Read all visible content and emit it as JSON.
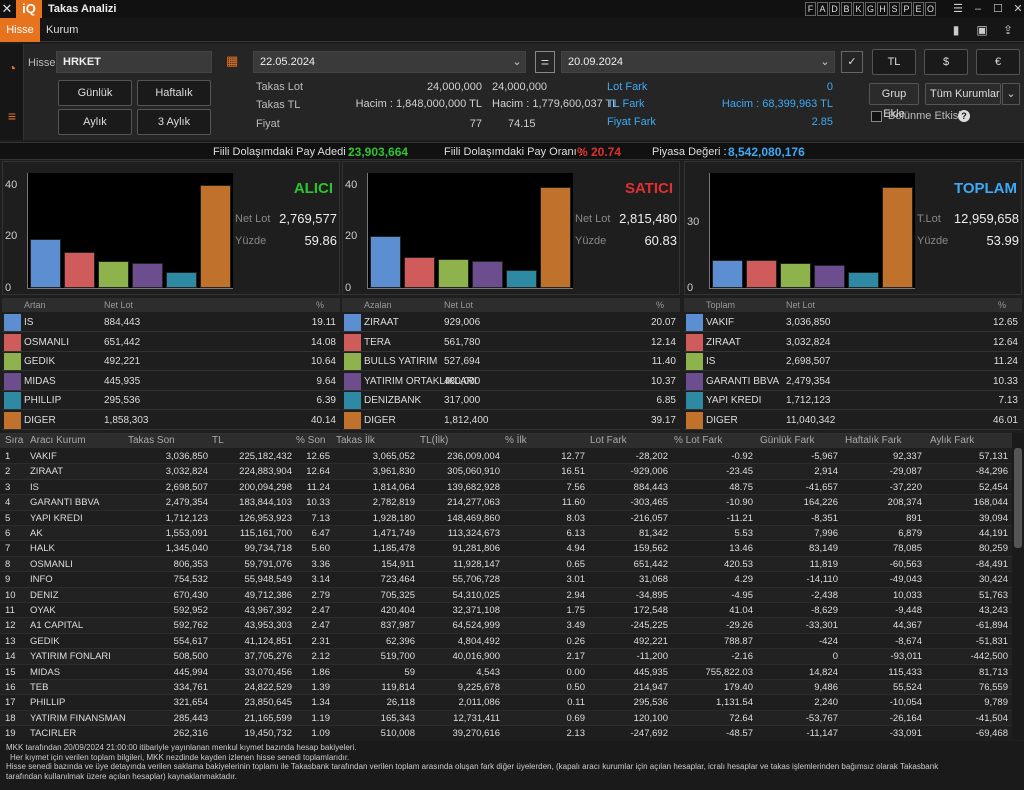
{
  "window": {
    "title": "Takas Analizi",
    "letters": [
      "F",
      "A",
      "D",
      "B",
      "K",
      "G",
      "H",
      "S",
      "P",
      "E",
      "O"
    ]
  },
  "menu": {
    "hisse": "Hisse",
    "kurum": "Kurum"
  },
  "form": {
    "hisse_label": "Hisse",
    "hisse_value": "HRKET",
    "date_from": "22.05.2024",
    "date_to": "20.09.2024",
    "eq": "=",
    "cur_tl": "TL",
    "cur_usd": "$",
    "cur_eur": "€",
    "btn_gunluk": "Günlük",
    "btn_haftalik": "Haftalık",
    "btn_aylik": "Aylık",
    "btn_3aylik": "3 Aylık",
    "grup_ekle": "Grup Ekle",
    "tum_kurumlar": "Tüm Kurumlar",
    "bolunme": "Bölünme Etkisi"
  },
  "summary": {
    "takas_lot_label": "Takas Lot",
    "takas_tl_label": "Takas TL",
    "fiyat_label": "Fiyat",
    "lot_1": "24,000,000",
    "lot_2": "24,000,000",
    "hacim_1": "Hacim : 1,848,000,000 TL",
    "hacim_2": "Hacim : 1,779,600,037 TL",
    "fiyat_1": "77",
    "fiyat_2": "74.15",
    "lot_fark_label": "Lot Fark",
    "lot_fark": "0",
    "tl_fark_label": "TL Fark",
    "tl_fark": "Hacim : 68,399,963 TL",
    "fiyat_fark_label": "Fiyat Fark",
    "fiyat_fark": "2.85"
  },
  "stats": {
    "pay_adedi_label": "Fiili Dolaşımdaki Pay Adedi :",
    "pay_adedi": "23,903,664",
    "pay_orani_label": "Fiili Dolaşımdaki Pay Oranı :",
    "pay_orani": "% 20.74",
    "piyasa_label": "Piyasa Değeri :",
    "piyasa": "8,542,080,176"
  },
  "colors": [
    "#5b8fd1",
    "#d05b5b",
    "#8fb34c",
    "#6c4d8e",
    "#2e8aa3",
    "#c0722c"
  ],
  "chart_data": [
    {
      "type": "bar",
      "title": "ALICI",
      "title_color": "#2fc42f",
      "ylim": [
        0,
        45
      ],
      "yticks": [
        0,
        20,
        40
      ],
      "values": [
        19.11,
        14.08,
        10.64,
        9.64,
        6.39,
        40.14
      ],
      "net_lot_label": "Net Lot",
      "net_lot": "2,769,577",
      "yuzde_label": "Yüzde",
      "yuzde": "59.86"
    },
    {
      "type": "bar",
      "title": "SATICI",
      "title_color": "#e03030",
      "ylim": [
        0,
        45
      ],
      "yticks": [
        0,
        20,
        40
      ],
      "values": [
        20.07,
        12.14,
        11.4,
        10.37,
        6.85,
        39.17
      ],
      "net_lot_label": "Net Lot",
      "net_lot": "2,815,480",
      "yuzde_label": "Yüzde",
      "yuzde": "60.83"
    },
    {
      "type": "bar",
      "title": "TOPLAM",
      "title_color": "#3fa9f5",
      "ylim": [
        0,
        53
      ],
      "yticks": [
        0,
        30
      ],
      "values": [
        12.65,
        12.64,
        11.24,
        10.33,
        7.13,
        46.01
      ],
      "net_lot_label": "T.Lot",
      "net_lot": "12,959,658",
      "yuzde_label": "Yüzde",
      "yuzde": "53.99"
    }
  ],
  "small_tables": [
    {
      "h1": "Artan",
      "h2": "Net Lot",
      "h3": "%",
      "rows": [
        [
          "IS",
          "884,443",
          "19.11"
        ],
        [
          "OSMANLI",
          "651,442",
          "14.08"
        ],
        [
          "GEDIK",
          "492,221",
          "10.64"
        ],
        [
          "MIDAS",
          "445,935",
          "9.64"
        ],
        [
          "PHILLIP",
          "295,536",
          "6.39"
        ],
        [
          "DIGER",
          "1,858,303",
          "40.14"
        ]
      ]
    },
    {
      "h1": "Azalan",
      "h2": "Net Lot",
      "h3": "%",
      "rows": [
        [
          "ZIRAAT",
          "929,006",
          "20.07"
        ],
        [
          "TERA",
          "561,780",
          "12.14"
        ],
        [
          "BULLS YATIRIM",
          "527,694",
          "11.40"
        ],
        [
          "YATIRIM ORTAKLIKLARI",
          "480,000",
          "10.37"
        ],
        [
          "DENIZBANK",
          "317,000",
          "6.85"
        ],
        [
          "DIGER",
          "1,812,400",
          "39.17"
        ]
      ]
    },
    {
      "h1": "Toplam",
      "h2": "Net Lot",
      "h3": "%",
      "rows": [
        [
          "VAKIF",
          "3,036,850",
          "12.65"
        ],
        [
          "ZIRAAT",
          "3,032,824",
          "12.64"
        ],
        [
          "IS",
          "2,698,507",
          "11.24"
        ],
        [
          "GARANTI BBVA",
          "2,479,354",
          "10.33"
        ],
        [
          "YAPI KREDI",
          "1,712,123",
          "7.13"
        ],
        [
          "DIGER",
          "11,040,342",
          "46.01"
        ]
      ]
    }
  ],
  "big_table": {
    "headers": [
      "Sıra",
      "Aracı Kurum",
      "Takas Son",
      "TL",
      "% Son",
      "Takas İlk",
      "TL(İlk)",
      "% İlk",
      "Lot Fark",
      "% Lot Fark",
      "Günlük Fark",
      "Haftalık Fark",
      "Aylık Fark"
    ],
    "rows": [
      [
        "1",
        "VAKIF",
        "3,036,850",
        "225,182,432",
        "12.65",
        "3,065,052",
        "236,009,004",
        "12.77",
        "-28,202",
        "-0.92",
        "-5,967",
        "92,337",
        "57,131"
      ],
      [
        "2",
        "ZIRAAT",
        "3,032,824",
        "224,883,904",
        "12.64",
        "3,961,830",
        "305,060,910",
        "16.51",
        "-929,006",
        "-23.45",
        "2,914",
        "-29,087",
        "-84,296"
      ],
      [
        "3",
        "IS",
        "2,698,507",
        "200,094,298",
        "11.24",
        "1,814,064",
        "139,682,928",
        "7.56",
        "884,443",
        "48.75",
        "-41,657",
        "-37,220",
        "52,454"
      ],
      [
        "4",
        "GARANTI BBVA",
        "2,479,354",
        "183,844,103",
        "10.33",
        "2,782,819",
        "214,277,063",
        "11.60",
        "-303,465",
        "-10.90",
        "164,226",
        "208,374",
        "168,044"
      ],
      [
        "5",
        "YAPI KREDI",
        "1,712,123",
        "126,953,923",
        "7.13",
        "1,928,180",
        "148,469,860",
        "8.03",
        "-216,057",
        "-11.21",
        "-8,351",
        "891",
        "39,094"
      ],
      [
        "6",
        "AK",
        "1,553,091",
        "115,161,700",
        "6.47",
        "1,471,749",
        "113,324,673",
        "6.13",
        "81,342",
        "5.53",
        "7,996",
        "6,879",
        "44,191"
      ],
      [
        "7",
        "HALK",
        "1,345,040",
        "99,734,718",
        "5.60",
        "1,185,478",
        "91,281,806",
        "4.94",
        "159,562",
        "13.46",
        "83,149",
        "78,085",
        "80,259"
      ],
      [
        "8",
        "OSMANLI",
        "806,353",
        "59,791,076",
        "3.36",
        "154,911",
        "11,928,147",
        "0.65",
        "651,442",
        "420.53",
        "11,819",
        "-60,563",
        "-84,491"
      ],
      [
        "9",
        "INFO",
        "754,532",
        "55,948,549",
        "3.14",
        "723,464",
        "55,706,728",
        "3.01",
        "31,068",
        "4.29",
        "-14,110",
        "-49,043",
        "30,424"
      ],
      [
        "10",
        "DENIZ",
        "670,430",
        "49,712,386",
        "2.79",
        "705,325",
        "54,310,025",
        "2.94",
        "-34,895",
        "-4.95",
        "-2,438",
        "10,033",
        "51,763"
      ],
      [
        "11",
        "OYAK",
        "592,952",
        "43,967,392",
        "2.47",
        "420,404",
        "32,371,108",
        "1.75",
        "172,548",
        "41.04",
        "-8,629",
        "-9,448",
        "43,243"
      ],
      [
        "12",
        "A1 CAPITAL",
        "592,762",
        "43,953,303",
        "2.47",
        "837,987",
        "64,524,999",
        "3.49",
        "-245,225",
        "-29.26",
        "-33,301",
        "44,367",
        "-61,894"
      ],
      [
        "13",
        "GEDIK",
        "554,617",
        "41,124,851",
        "2.31",
        "62,396",
        "4,804,492",
        "0.26",
        "492,221",
        "788.87",
        "-424",
        "-8,674",
        "-51,831"
      ],
      [
        "14",
        "YATIRIM FONLARI",
        "508,500",
        "37,705,276",
        "2.12",
        "519,700",
        "40,016,900",
        "2.17",
        "-11,200",
        "-2.16",
        "0",
        "-93,011",
        "-442,500"
      ],
      [
        "15",
        "MIDAS",
        "445,994",
        "33,070,456",
        "1.86",
        "59",
        "4,543",
        "0.00",
        "445,935",
        "755,822.03",
        "14,824",
        "115,433",
        "81,713"
      ],
      [
        "16",
        "TEB",
        "334,761",
        "24,822,529",
        "1.39",
        "119,814",
        "9,225,678",
        "0.50",
        "214,947",
        "179.40",
        "9,486",
        "55,524",
        "76,559"
      ],
      [
        "17",
        "PHILLIP",
        "321,654",
        "23,850,645",
        "1.34",
        "26,118",
        "2,011,086",
        "0.11",
        "295,536",
        "1,131.54",
        "2,240",
        "-10,054",
        "9,789"
      ],
      [
        "18",
        "YATIRIM FINANSMAN",
        "285,443",
        "21,165,599",
        "1.19",
        "165,343",
        "12,731,411",
        "0.69",
        "120,100",
        "72.64",
        "-53,767",
        "-26,164",
        "-41,504"
      ],
      [
        "19",
        "TACIRLER",
        "262,316",
        "19,450,732",
        "1.09",
        "510,008",
        "39,270,616",
        "2.13",
        "-247,692",
        "-48.57",
        "-11,147",
        "-33,091",
        "-69,468"
      ]
    ]
  },
  "footer": [
    "MKK tarafından 20/09/2024 21:00:00 itibariyle yayınlanan menkul kıymet bazında hesap bakiyeleri.",
    "Her kıymet için verilen toplam bilgileri, MKK nezdinde kayden izlenen hisse senedi toplamlarıdır.",
    "Hisse senedi bazında ve üye detayında verilen saklama bakiyelerinin toplamı ile Takasbank tarafından verilen toplam arasında oluşan fark diğer üyelerden, (kapalı aracı kurumlar için açılan hesaplar, icralı hesaplar ve takas işlemlerinden bağımsız olarak Takasbank",
    "tarafından kullanılmak üzere açılan hesaplar) kaynaklanmaktadır."
  ]
}
